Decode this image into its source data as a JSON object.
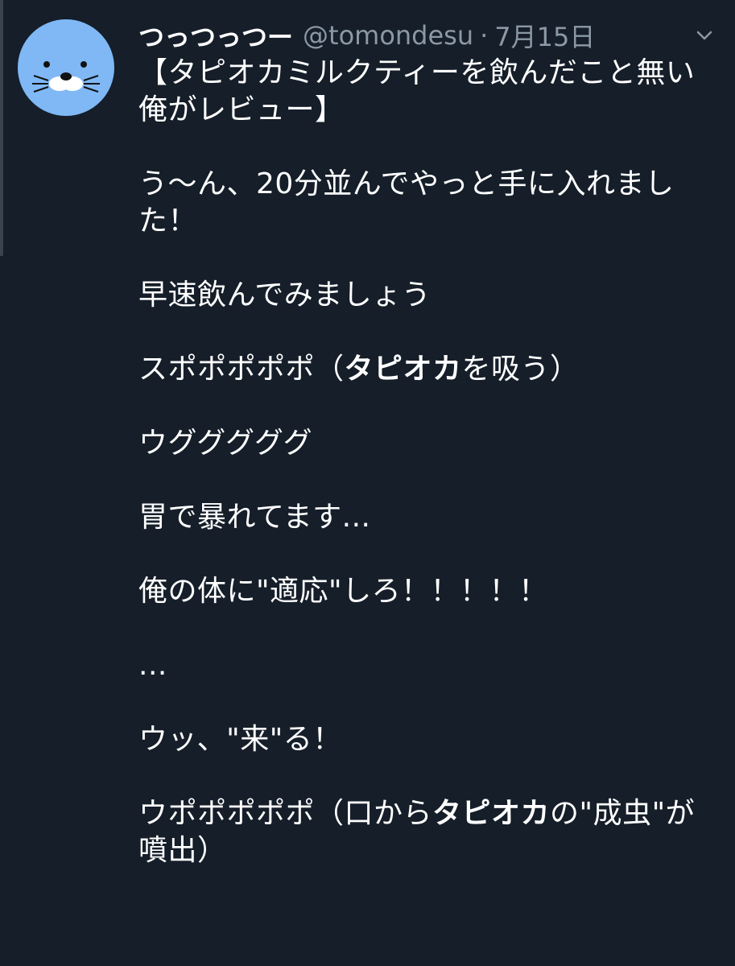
{
  "tweet": {
    "display_name": "つっつっつー",
    "handle": "@tomondesu",
    "separator": "·",
    "date": "7月15日",
    "avatar_color": "#7fb8f5",
    "menu_icon": "chevron-down-icon",
    "paragraphs": {
      "p1_line1": "【タピオカミルクティーを飲んだこと無い",
      "p1_line2": "俺がレビュー】",
      "p2_line1": "う〜ん、20分並んでやっと手に入れまし",
      "p2_line2": "た！",
      "p3": "早速飲んでみましょう",
      "p4_pre": "スポポポポポ（",
      "p4_bold": "タピオカ",
      "p4_post": "を吸う）",
      "p5": "ウグググググ",
      "p6": "胃で暴れてます...",
      "p7": "俺の体に\"適応\"しろ！！！！！",
      "p8": "...",
      "p9": "ウッ、\"来\"る！",
      "p10_pre": "ウポポポポポ（口から",
      "p10_bold": "タピオカ",
      "p10_post": "の\"成虫\"が",
      "p10_line2": "噴出）"
    }
  }
}
